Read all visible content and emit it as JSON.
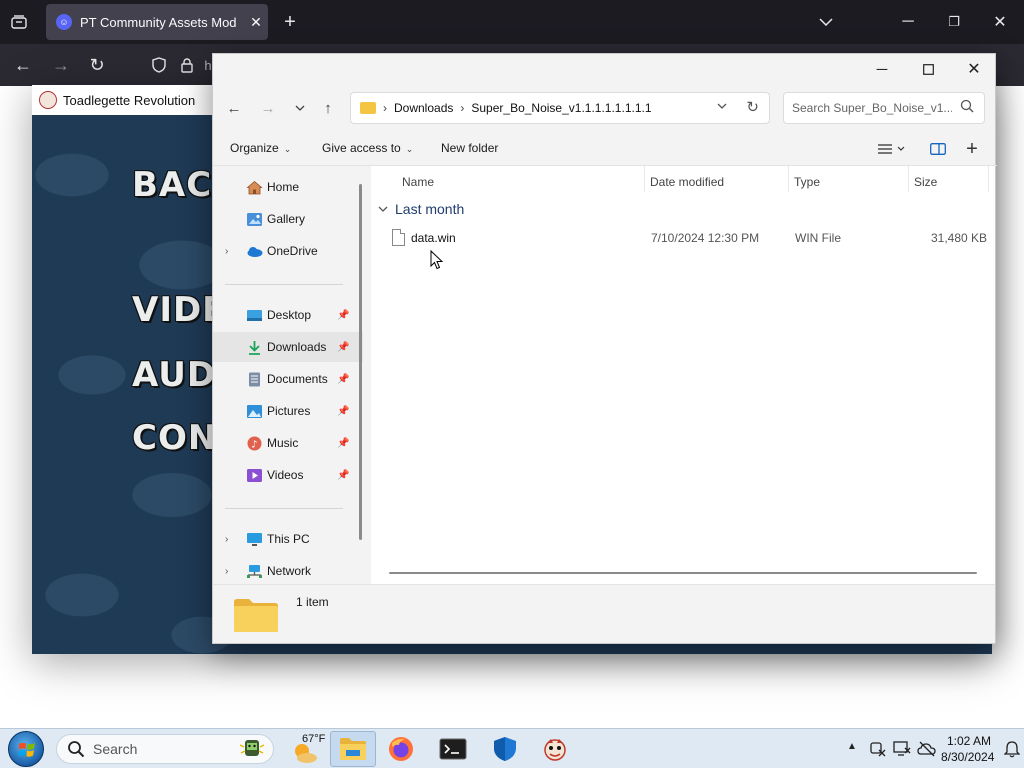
{
  "browser": {
    "tab_title": "PT Community Assets Mod",
    "tab_favicon": "discord-icon",
    "address_partial": "h"
  },
  "game_window": {
    "title": "Toadlegette Revolution",
    "menu_items": [
      "BACK",
      "VIDEO",
      "AUDIO",
      "CONTROLS"
    ]
  },
  "explorer": {
    "caption_buttons": [
      "minimize",
      "maximize",
      "close"
    ],
    "breadcrumb": [
      "Downloads",
      "Super_Bo_Noise_v1.1.1.1.1.1.1.1"
    ],
    "search_placeholder": "Search Super_Bo_Noise_v1...",
    "toolbar": {
      "organize": "Organize",
      "give_access": "Give access to",
      "new_folder": "New folder"
    },
    "nav": {
      "top": [
        {
          "label": "Home",
          "icon": "home-icon"
        },
        {
          "label": "Gallery",
          "icon": "gallery-icon"
        },
        {
          "label": "OneDrive",
          "icon": "onedrive-icon",
          "expandable": true
        }
      ],
      "pinned": [
        {
          "label": "Desktop",
          "icon": "desktop-icon"
        },
        {
          "label": "Downloads",
          "icon": "downloads-icon",
          "selected": true
        },
        {
          "label": "Documents",
          "icon": "documents-icon"
        },
        {
          "label": "Pictures",
          "icon": "pictures-icon"
        },
        {
          "label": "Music",
          "icon": "music-icon"
        },
        {
          "label": "Videos",
          "icon": "videos-icon"
        }
      ],
      "bottom": [
        {
          "label": "This PC",
          "icon": "this-pc-icon",
          "expandable": true
        },
        {
          "label": "Network",
          "icon": "network-icon",
          "expandable": true
        }
      ]
    },
    "columns": [
      "Name",
      "Date modified",
      "Type",
      "Size"
    ],
    "group_label": "Last month",
    "files": [
      {
        "name": "data.win",
        "date": "7/10/2024 12:30 PM",
        "type": "WIN File",
        "size": "31,480 KB"
      }
    ],
    "status": "1 item"
  },
  "taskbar": {
    "search_label": "Search",
    "weather_temp": "67°F",
    "clock_time": "1:02 AM",
    "clock_date": "8/30/2024"
  },
  "colors": {
    "game_bg": "#1f3a55",
    "selected_nav": "#e5e5e5",
    "group_header": "#1f3d6e",
    "taskbar": "#dfe9f3"
  }
}
